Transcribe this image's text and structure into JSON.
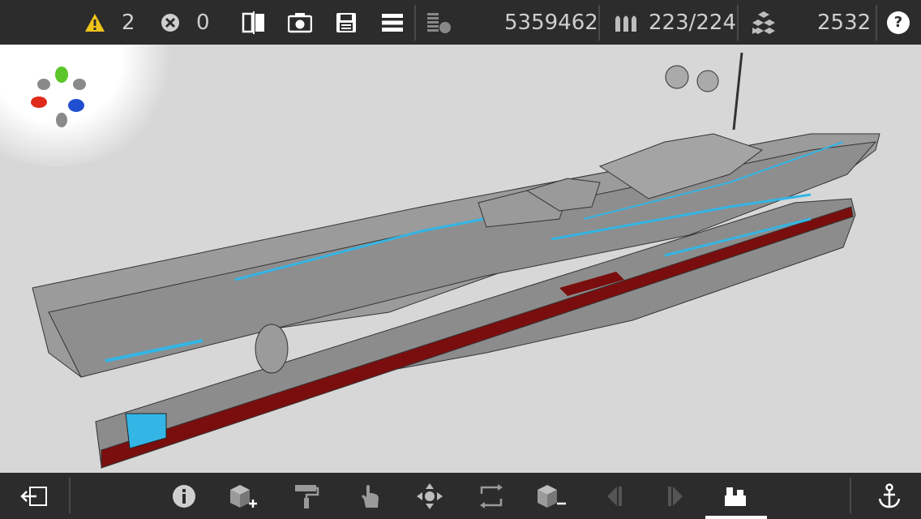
{
  "topbar": {
    "warnings_count": "2",
    "errors_count": "0",
    "cost_value": "5359462",
    "ammo_value": "223/224",
    "blocks_value": "2532",
    "help_label": "?"
  },
  "icons": {
    "warning": "warning-triangle-icon",
    "error": "error-circle-icon",
    "mirror": "mirror-split-icon",
    "screenshot": "camera-icon",
    "save": "floppy-disk-icon",
    "menu": "menu-icon",
    "budget": "budget-stack-icon",
    "ammo": "ammo-icon",
    "blocks": "blocks-icon"
  },
  "colors": {
    "warning_yellow": "#f0c419",
    "accent_blue": "#33b5e5",
    "hull_red": "#7a0e0e",
    "bar_bg": "#2c2c2c"
  },
  "bottombar": {
    "tools": [
      "exit",
      "info",
      "add-block",
      "paint",
      "hand",
      "move",
      "rotate",
      "remove-block",
      "prev",
      "next",
      "camera-mode",
      "anchor"
    ],
    "active_tool": "camera-mode"
  }
}
